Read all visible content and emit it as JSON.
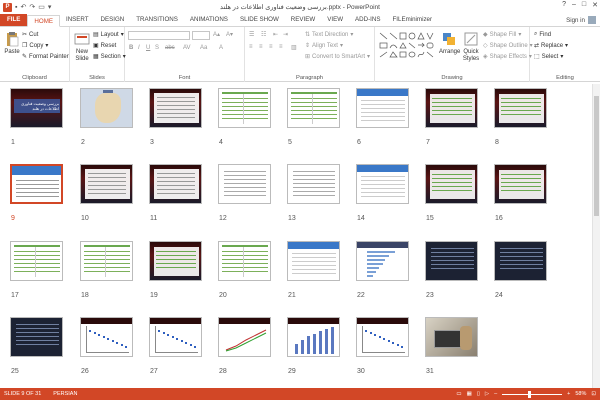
{
  "titlebar": {
    "doc_title": "بررسی وضعیت فناوری اطلاعات در هلند.pptx - PowerPoint",
    "controls": [
      "?",
      "–",
      "□",
      "✕"
    ]
  },
  "tabs": [
    "FILE",
    "HOME",
    "INSERT",
    "DESIGN",
    "TRANSITIONS",
    "ANIMATIONS",
    "SLIDE SHOW",
    "REVIEW",
    "VIEW",
    "ADD-INS",
    "FILEminimizer"
  ],
  "active_tab": "HOME",
  "signin": "Sign in",
  "ribbon": {
    "clipboard": {
      "label": "Clipboard",
      "paste": "Paste",
      "cut": "Cut",
      "copy": "Copy",
      "format_painter": "Format Painter"
    },
    "slides": {
      "label": "Slides",
      "new_slide": "New Slide",
      "layout": "Layout",
      "reset": "Reset",
      "section": "Section"
    },
    "font": {
      "label": "Font"
    },
    "paragraph": {
      "label": "Paragraph",
      "text_direction": "Text Direction",
      "align_text": "Align Text",
      "convert_smartart": "Convert to SmartArt"
    },
    "drawing": {
      "label": "Drawing",
      "arrange": "Arrange",
      "quick_styles": "Quick Styles",
      "shape_fill": "Shape Fill",
      "shape_outline": "Shape Outline",
      "shape_effects": "Shape Effects"
    },
    "editing": {
      "label": "Editing",
      "find": "Find",
      "replace": "Replace",
      "select": "Select"
    }
  },
  "slides": [
    {
      "n": "1",
      "kind": "title-dark",
      "title": "بررسی وضعیت فناوری اطلاعات در هلند"
    },
    {
      "n": "2",
      "kind": "map"
    },
    {
      "n": "3",
      "kind": "dark-text"
    },
    {
      "n": "4",
      "kind": "table"
    },
    {
      "n": "5",
      "kind": "table"
    },
    {
      "n": "6",
      "kind": "blue-table"
    },
    {
      "n": "7",
      "kind": "dark-lines"
    },
    {
      "n": "8",
      "kind": "dark-lines"
    },
    {
      "n": "9",
      "kind": "blue-text",
      "selected": true
    },
    {
      "n": "10",
      "kind": "dark-text"
    },
    {
      "n": "11",
      "kind": "dark-text"
    },
    {
      "n": "12",
      "kind": "text"
    },
    {
      "n": "13",
      "kind": "text"
    },
    {
      "n": "14",
      "kind": "blue-table"
    },
    {
      "n": "15",
      "kind": "dark-lines"
    },
    {
      "n": "16",
      "kind": "dark-lines"
    },
    {
      "n": "17",
      "kind": "table"
    },
    {
      "n": "18",
      "kind": "table"
    },
    {
      "n": "19",
      "kind": "dark-lines"
    },
    {
      "n": "20",
      "kind": "table"
    },
    {
      "n": "21",
      "kind": "blue-table"
    },
    {
      "n": "22",
      "kind": "bar-chart"
    },
    {
      "n": "23",
      "kind": "dark-rows"
    },
    {
      "n": "24",
      "kind": "dark-rows"
    },
    {
      "n": "25",
      "kind": "dark-rows"
    },
    {
      "n": "26",
      "kind": "chart-scatter"
    },
    {
      "n": "27",
      "kind": "chart-scatter"
    },
    {
      "n": "28",
      "kind": "chart-line"
    },
    {
      "n": "29",
      "kind": "chart-bars"
    },
    {
      "n": "30",
      "kind": "chart-scatter"
    },
    {
      "n": "31",
      "kind": "photo"
    }
  ],
  "status": {
    "slide_info": "SLIDE 9 OF 31",
    "language": "PERSIAN",
    "zoom": "58%",
    "zoom_fraction": 0.45
  }
}
